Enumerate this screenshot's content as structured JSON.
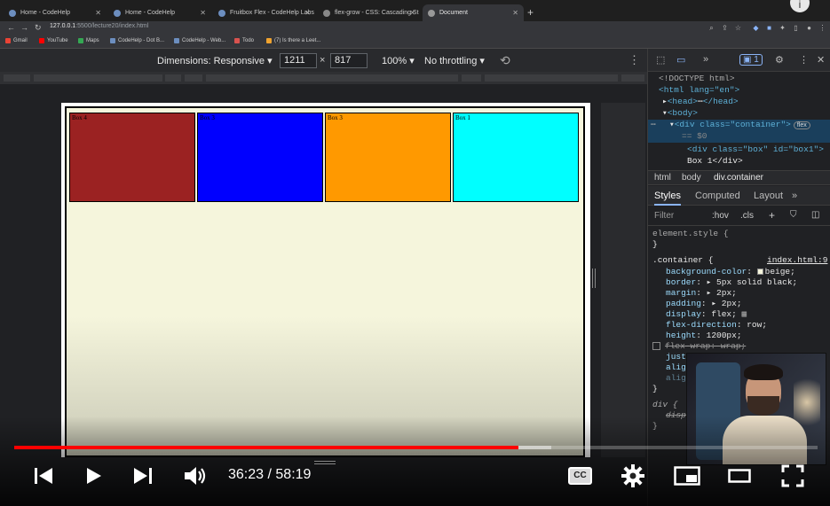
{
  "browser": {
    "tabs": [
      {
        "label": "Home - CodeHelp",
        "active": false
      },
      {
        "label": "Home - CodeHelp",
        "active": false
      },
      {
        "label": "Fruitbox Flex - CodeHelp Labs",
        "active": false
      },
      {
        "label": "flex-grow - CSS: Cascading St",
        "active": false
      },
      {
        "label": "Document",
        "active": true
      }
    ],
    "new_tab": "+",
    "profile_initial": "i",
    "url_host": "127.0.0.1",
    "url_rest": ":5500/lecture20/index.html",
    "bookmarks": [
      "Gmail",
      "YouTube",
      "Maps",
      "CodeHelp - Dot B...",
      "CodeHelp - Web...",
      "Todo",
      "(7) Is there a Leet..."
    ]
  },
  "device_toolbar": {
    "dimensions_label": "Dimensions: Responsive ▾",
    "width": "1211",
    "height": "817",
    "times": "×",
    "zoom": "100% ▾",
    "throttling": "No throttling ▾"
  },
  "page": {
    "boxes": [
      {
        "label": "Box 4",
        "color": "#9b2222"
      },
      {
        "label": "Box 3",
        "color": "#0000ff"
      },
      {
        "label": "Box 3",
        "color": "#ff9900"
      },
      {
        "label": "Box 1",
        "color": "#00ffff"
      }
    ]
  },
  "devtools": {
    "issues_count": "1",
    "dom": {
      "doctype": "<!DOCTYPE html>",
      "html_open": "<html lang=\"en\">",
      "head": "<head>",
      "head_close": "</head>",
      "body": "<body>",
      "div_container": "<div class=\"container\">",
      "flex_badge": "flex",
      "eq": "== $0",
      "div_box": "<div class=\"box\" id=\"box1\">",
      "box_text": "Box 1</div>"
    },
    "breadcrumbs": [
      "html",
      "body",
      "div.container"
    ],
    "panel_tabs": [
      "Styles",
      "Computed",
      "Layout",
      "»"
    ],
    "filter_placeholder": "Filter",
    "hov": ":hov",
    "cls": ".cls",
    "styles": {
      "element_style": "element.style {",
      "close": "}",
      "selector": ".container {",
      "source": "index.html:9",
      "props": [
        {
          "name": "background-color",
          "value": "beige;"
        },
        {
          "name": "border",
          "value": "▸ 5px solid  black;"
        },
        {
          "name": "margin",
          "value": "▸ 2px;"
        },
        {
          "name": "padding",
          "value": "▸ 2px;"
        },
        {
          "name": "display",
          "value": "flex;"
        },
        {
          "name": "flex-direction",
          "value": "row;"
        },
        {
          "name": "height",
          "value": "1200px;"
        },
        {
          "name": "flex-wrap",
          "value": "wrap;"
        },
        {
          "name": "just",
          "value": ""
        },
        {
          "name": "alig",
          "value": ""
        },
        {
          "name": "alig",
          "value": ""
        }
      ],
      "div_selector": "div {",
      "disp": "disp"
    }
  },
  "player": {
    "time_current": "36:23",
    "time_separator": "/",
    "time_total": "58:19",
    "played_fraction": 0.628,
    "buffered_fraction": 0.668,
    "cc_label": "CC"
  }
}
